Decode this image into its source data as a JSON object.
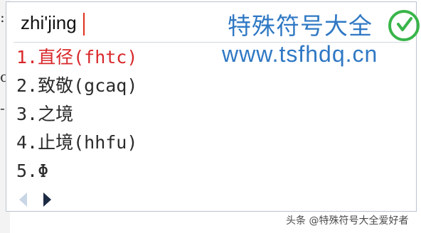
{
  "ime": {
    "composition": "zhi'jing",
    "candidates": [
      {
        "label": "1.直径(fhtc)",
        "selected": true
      },
      {
        "label": "2.致敬(gcaq)",
        "selected": false
      },
      {
        "label": "3.之境",
        "selected": false
      },
      {
        "label": "4.止境(hhfu)",
        "selected": false
      },
      {
        "label": "5.Φ",
        "selected": false
      }
    ],
    "pager": {
      "prev_icon": "triangle-left",
      "next_icon": "triangle-right"
    }
  },
  "watermark": {
    "site_name": "特殊符号大全",
    "site_url": "www.tsfhdq.cn"
  },
  "credit": "头条 @特殊符号大全爱好者",
  "colors": {
    "selected_candidate": "#d9282b",
    "watermark": "#2f78c4",
    "caret": "#e0301e",
    "logo_green": "#39b54a"
  }
}
